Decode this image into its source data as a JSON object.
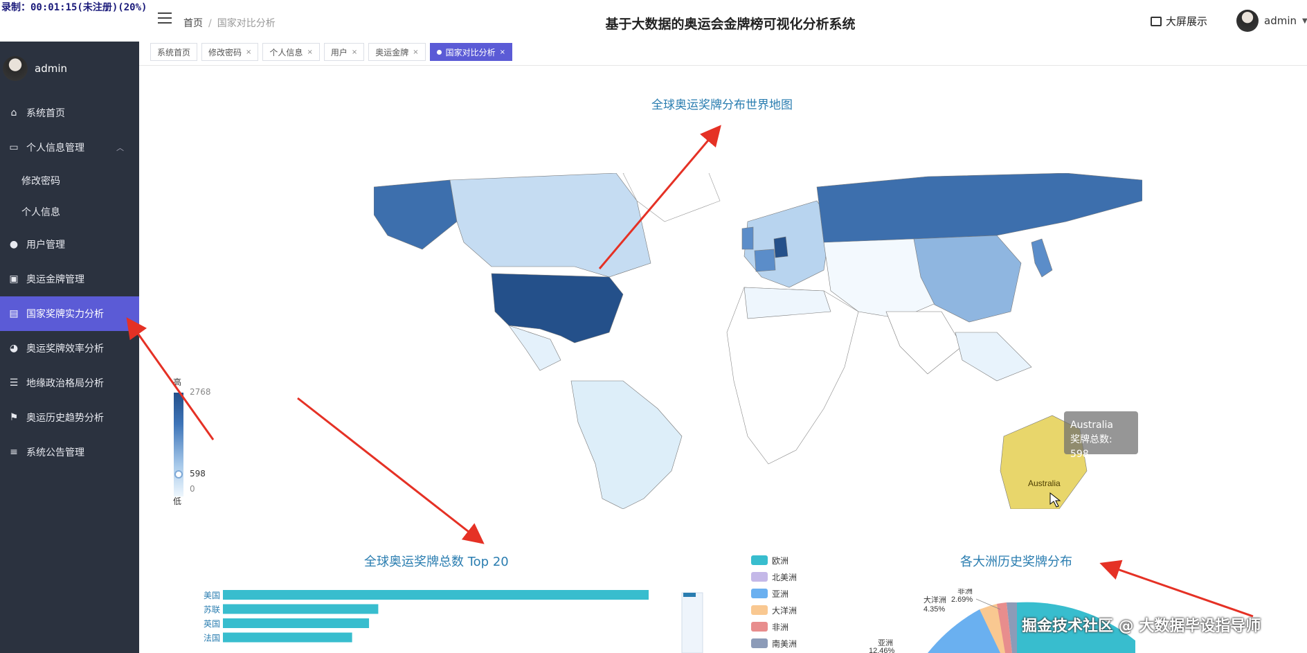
{
  "overlay": {
    "recording": "录制：00:01:15(未注册)(20%)"
  },
  "header": {
    "title": "基于大数据的奥运会金牌榜可视化分析系统",
    "breadcrumb_home": "首页",
    "breadcrumb_sep": "/",
    "breadcrumb_current": "国家对比分析",
    "bigscreen_label": "大屏展示",
    "username": "admin"
  },
  "sidebar": {
    "username": "admin",
    "items": [
      {
        "label": "系统首页",
        "icon": "home-icon"
      },
      {
        "label": "个人信息管理",
        "icon": "card-icon"
      },
      {
        "label": "修改密码",
        "icon": ""
      },
      {
        "label": "个人信息",
        "icon": ""
      },
      {
        "label": "用户管理",
        "icon": "user-icon"
      },
      {
        "label": "奥运金牌管理",
        "icon": "clipboard-icon"
      },
      {
        "label": "国家奖牌实力分析",
        "icon": "chart-card-icon"
      },
      {
        "label": "奥运奖牌效率分析",
        "icon": "bulb-icon"
      },
      {
        "label": "地缘政治格局分析",
        "icon": "sliders-icon"
      },
      {
        "label": "奥运历史趋势分析",
        "icon": "flag-icon"
      },
      {
        "label": "系统公告管理",
        "icon": "list-icon"
      }
    ]
  },
  "tabs": [
    {
      "label": "系统首页"
    },
    {
      "label": "修改密码"
    },
    {
      "label": "个人信息"
    },
    {
      "label": "用户"
    },
    {
      "label": "奥运金牌"
    },
    {
      "label": "国家对比分析"
    }
  ],
  "map": {
    "title": "全球奥运奖牌分布世界地图",
    "visualmap_high": "高",
    "visualmap_low": "低",
    "visualmap_max": "2768",
    "visualmap_min": "0",
    "visualmap_current": "598",
    "visualmap_current_value": 598,
    "tooltip_country": "Australia",
    "tooltip_label": "奖牌总数: 598",
    "highlighted_label": "Australia"
  },
  "chart_data": [
    {
      "type": "bar",
      "title": "全球奥运奖牌总数 Top 20",
      "categories": [
        "美国",
        "苏联",
        "英国",
        "法国"
      ],
      "values": [
        2768,
        1010,
        950,
        840
      ]
    },
    {
      "type": "pie",
      "title": "各大洲历史奖牌分布",
      "legend": [
        "欧洲",
        "北美洲",
        "亚洲",
        "大洋洲",
        "非洲",
        "南美洲"
      ],
      "colors": [
        "#38bdce",
        "#c4b8e8",
        "#6ab0f0",
        "#f9c891",
        "#e88d8d",
        "#8c9bb8"
      ],
      "labels": [
        {
          "name": "大洋洲",
          "value": "4.35%"
        },
        {
          "name": "非洲",
          "value": "2.69%"
        },
        {
          "name": "亚洲",
          "value": "12.46%"
        }
      ]
    }
  ],
  "watermark": "掘金技术社区 @ 大数据毕设指导师"
}
